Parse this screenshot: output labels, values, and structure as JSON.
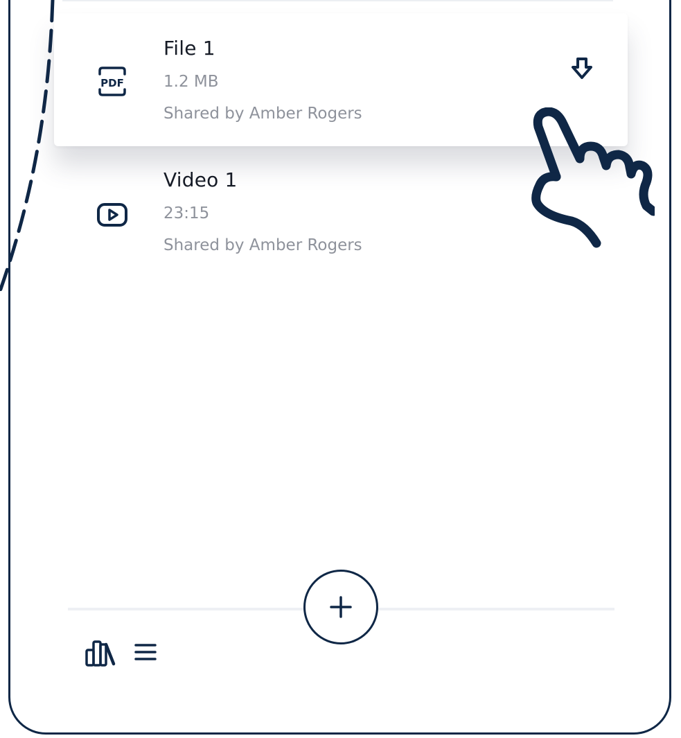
{
  "files": [
    {
      "title": "File 1",
      "meta": "1.2 MB",
      "shared_by": "Shared by Amber Rogers",
      "icon": "pdf-icon",
      "icon_text": "PDF"
    },
    {
      "title": "Video 1",
      "meta": "23:15",
      "shared_by": "Shared by Amber Rogers",
      "icon": "video-play-icon"
    }
  ],
  "actions": {
    "download_icon": "download-arrow-icon",
    "add_icon": "plus-icon",
    "hand_icon": "pointing-hand-icon"
  },
  "bottom_nav": {
    "library_icon": "library-books-icon",
    "menu_icon": "hamburger-menu-icon"
  },
  "colors": {
    "frame": "#0f2746",
    "text_primary": "#161b26",
    "text_secondary": "#8e929b",
    "divider": "#eef0f4"
  }
}
